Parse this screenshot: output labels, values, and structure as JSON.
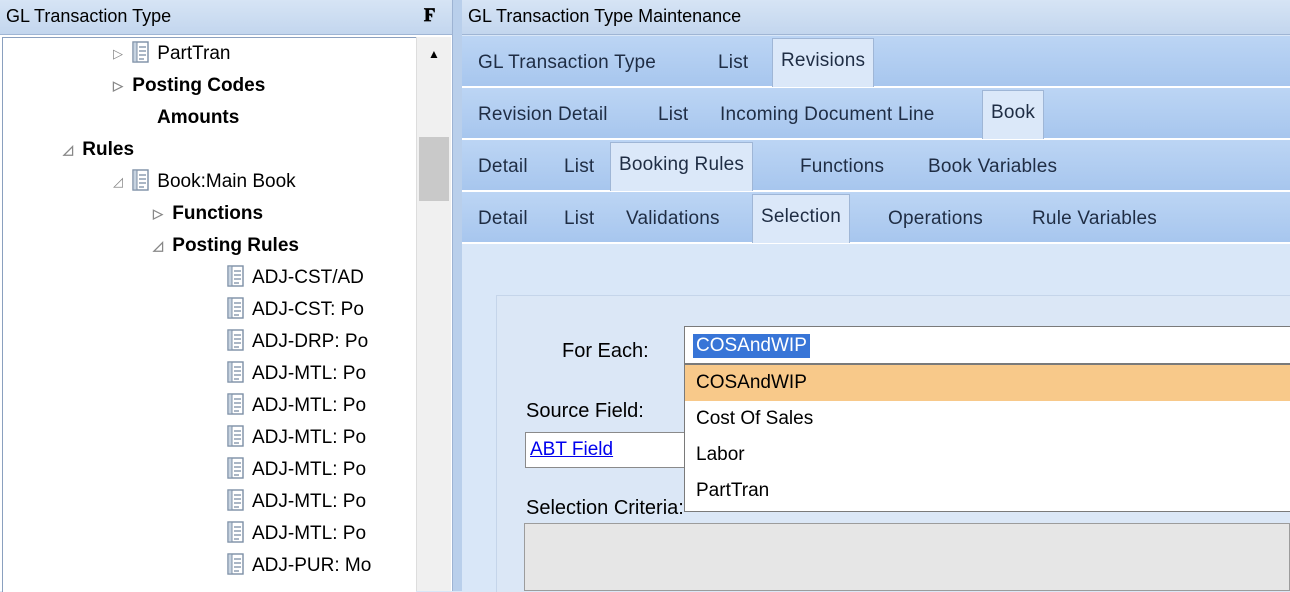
{
  "left_panel": {
    "title": "GL Transaction Type",
    "pin_glyph": "q",
    "tree": [
      {
        "label": "PartTran",
        "bold": false,
        "arrow": "▷",
        "icon": true
      },
      {
        "label": "Posting Codes",
        "bold": true,
        "arrow": "▷",
        "icon": false
      },
      {
        "label": "Amounts",
        "bold": true,
        "arrow": "",
        "icon": false
      },
      {
        "label": "Rules",
        "bold": true,
        "arrow": "◿",
        "icon": false
      },
      {
        "label": "Book:Main Book",
        "bold": false,
        "arrow": "◿",
        "icon": true
      },
      {
        "label": "Functions",
        "bold": true,
        "arrow": "▷",
        "icon": false
      },
      {
        "label": "Posting Rules",
        "bold": true,
        "arrow": "◿",
        "icon": false
      },
      {
        "label": "ADJ-CST/AD",
        "bold": false,
        "arrow": "",
        "icon": true
      },
      {
        "label": "ADJ-CST: Po",
        "bold": false,
        "arrow": "",
        "icon": true
      },
      {
        "label": "ADJ-DRP: Po",
        "bold": false,
        "arrow": "",
        "icon": true
      },
      {
        "label": "ADJ-MTL: Po",
        "bold": false,
        "arrow": "",
        "icon": true
      },
      {
        "label": "ADJ-MTL: Po",
        "bold": false,
        "arrow": "",
        "icon": true
      },
      {
        "label": "ADJ-MTL: Po",
        "bold": false,
        "arrow": "",
        "icon": true
      },
      {
        "label": "ADJ-MTL: Po",
        "bold": false,
        "arrow": "",
        "icon": true
      },
      {
        "label": "ADJ-MTL: Po",
        "bold": false,
        "arrow": "",
        "icon": true
      },
      {
        "label": "ADJ-MTL: Po",
        "bold": false,
        "arrow": "",
        "icon": true
      },
      {
        "label": "ADJ-PUR: Mo",
        "bold": false,
        "arrow": "",
        "icon": true
      }
    ]
  },
  "right_panel": {
    "title": "GL Transaction Type Maintenance",
    "tab_rows": [
      {
        "tabs": [
          "GL Transaction Type",
          "List",
          "Revisions"
        ],
        "active": 2
      },
      {
        "tabs": [
          "Revision Detail",
          "List",
          "Incoming Document Line",
          "Book"
        ],
        "active": 3
      },
      {
        "tabs": [
          "Detail",
          "List",
          "Booking Rules",
          "Functions",
          "Book Variables"
        ],
        "active": 2
      },
      {
        "tabs": [
          "Detail",
          "List",
          "Validations",
          "Selection",
          "Operations",
          "Rule Variables"
        ],
        "active": 3
      }
    ],
    "form": {
      "for_each_label": "For Each:",
      "for_each_value": "COSAndWIP",
      "source_field_label": "Source Field:",
      "source_field_link": "ABT Field",
      "selection_criteria_label": "Selection Criteria:",
      "dropdown_options": [
        "COSAndWIP",
        "Cost Of Sales",
        "Labor",
        "PartTran"
      ],
      "highlighted_option": 0
    }
  },
  "colors": {
    "tab_bg": "#a7c6ee",
    "highlight": "#f8c98a",
    "selection": "#3875d7",
    "link": "#0000ee"
  }
}
